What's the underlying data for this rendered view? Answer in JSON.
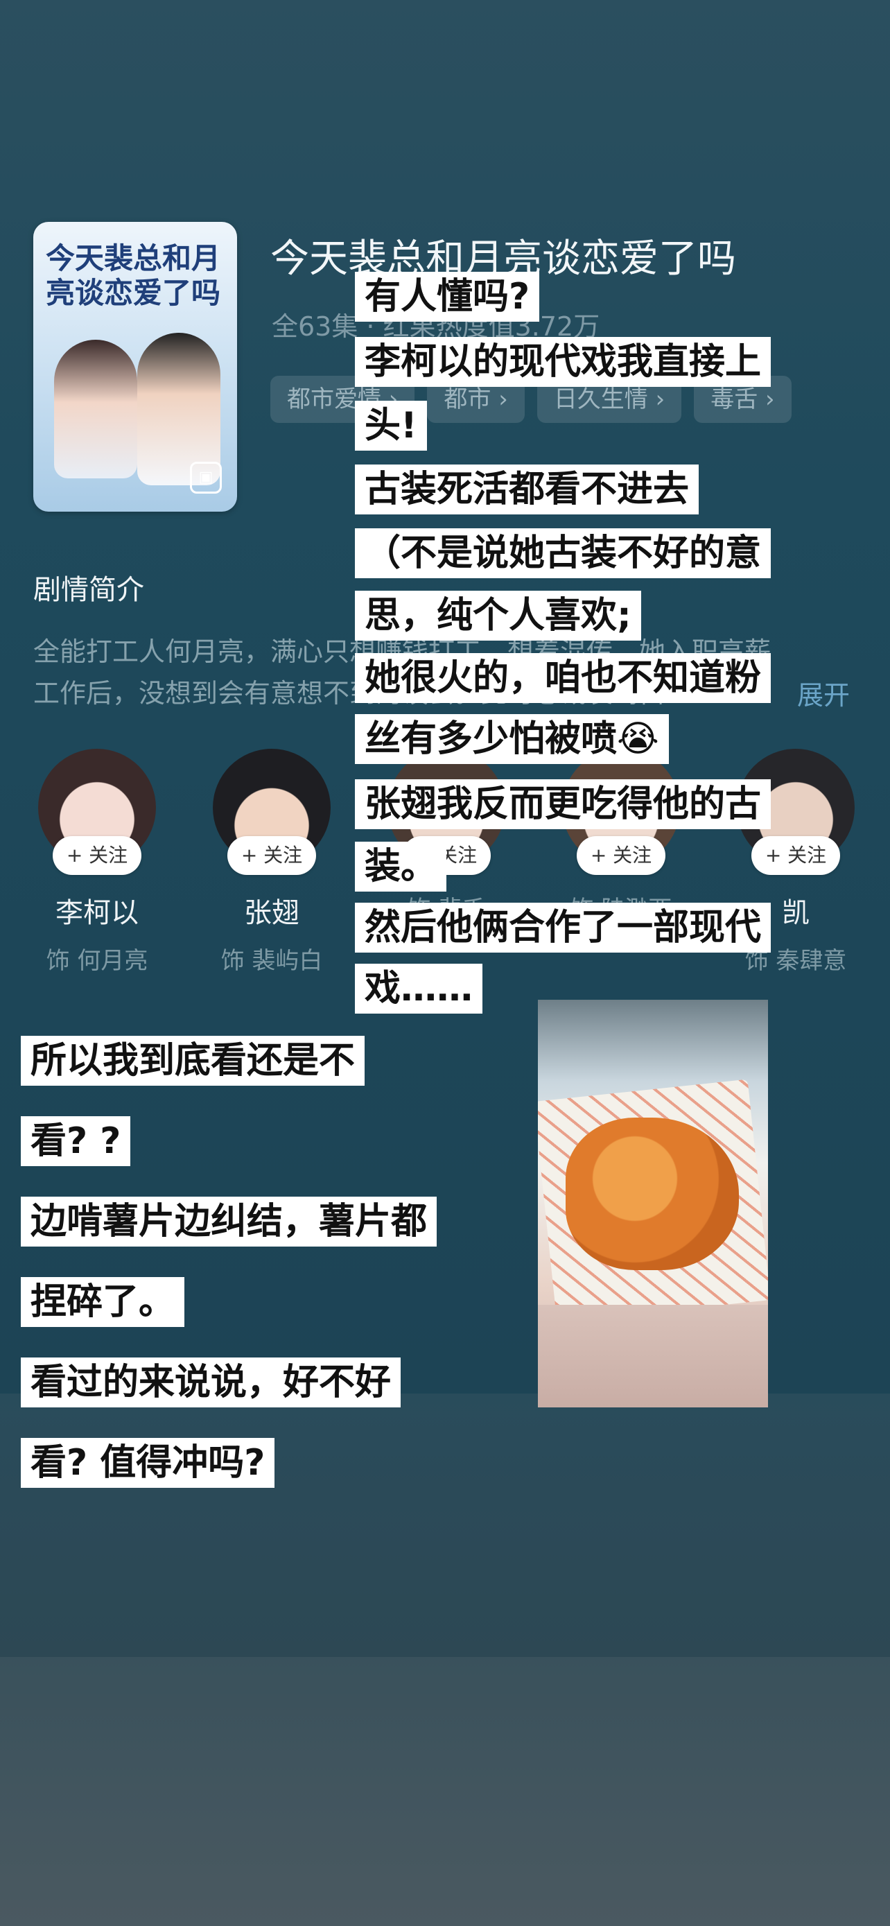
{
  "show": {
    "title": "今天裴总和月亮谈恋爱了吗",
    "meta": "全63集 · 红果热度值3.72万",
    "tags": [
      "都市爱情 ›",
      "都市 ›",
      "日久生情 ›",
      "毒舌 ›"
    ],
    "poster_text": "今天裴总和月亮谈恋爱了吗"
  },
  "synopsis": {
    "heading": "剧情简介",
    "line1": "全能打工人何月亮，满心只想赚钱打工，想着混传，她入职高薪",
    "line2": "工作后，没想到会有意想不到的误会。此时总裁裴屿白…",
    "expand": "展开"
  },
  "cast": [
    {
      "name": "李柯以",
      "role": "饰 何月亮",
      "follow": "+ 关注"
    },
    {
      "name": "张翅",
      "role": "饰 裴屿白",
      "follow": "+ 关注"
    },
    {
      "name": "",
      "role": "饰 裴千",
      "follow": "+ 关注"
    },
    {
      "name": "",
      "role": "饰 陆渺西",
      "follow": "+ 关注"
    },
    {
      "name": "凯",
      "role": "饰 秦肆意",
      "follow": "+ 关注"
    }
  ],
  "overlay_text": [
    "有人懂吗?",
    "李柯以的现代戏我直接上",
    "头!",
    "古装死活都看不进去",
    "（不是说她古装不好的意",
    "思，纯个人喜欢;",
    "她很火的，咱也不知道粉",
    "丝有多少怕被喷😭",
    "张翅我反而更吃得他的古",
    "装。",
    "然后他俩合作了一部现代",
    "戏……",
    "所以我到底看还是不",
    "看? ?",
    "边啃薯片边纠结，薯片都",
    "捏碎了。",
    "看过的来说说，好不好",
    "看? 值得冲吗?"
  ],
  "photo": {
    "icon": "chips-photo"
  },
  "colors": {
    "accent": "#6ba5c8",
    "background": "#1f4a5c"
  }
}
